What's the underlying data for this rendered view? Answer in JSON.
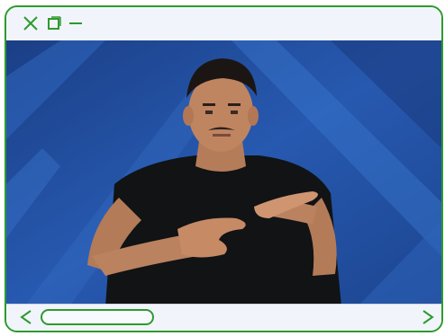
{
  "window": {
    "controls": [
      "close-icon",
      "maximize-icon",
      "minimize-icon"
    ],
    "accent_color": "#2e9a2e",
    "background_color": "#f1f5fb"
  },
  "video": {
    "content": "video-frame",
    "background_color": "#1f4e9a"
  },
  "navigation": {
    "prev_icon": "chevron-left-icon",
    "next_icon": "chevron-right-icon"
  }
}
